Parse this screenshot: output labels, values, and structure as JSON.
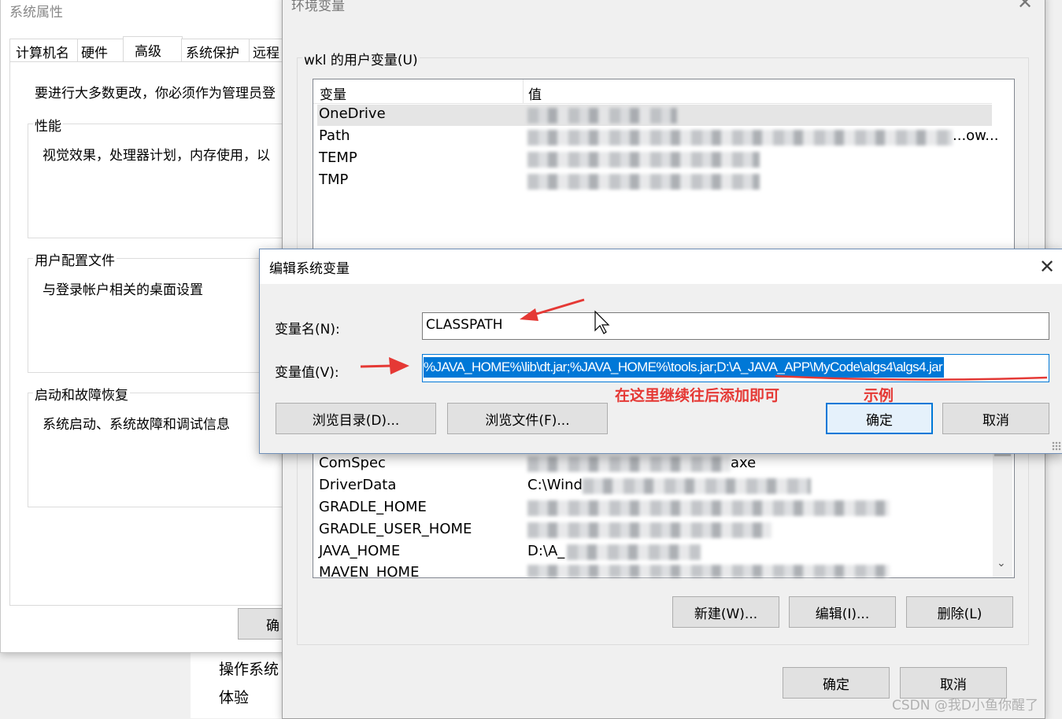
{
  "sys_props": {
    "title": "系统属性",
    "tabs": [
      "计算机名",
      "硬件",
      "高级",
      "系统保护",
      "远程"
    ],
    "admin_note": "要进行大多数更改，你必须作为管理员登",
    "perf_label": "性能",
    "perf_desc": "视觉效果，处理器计划，内存使用，以",
    "profile_label": "用户配置文件",
    "profile_desc": "与登录帐户相关的桌面设置",
    "startup_label": "启动和故障恢复",
    "startup_desc": "系统启动、系统故障和调试信息",
    "ok_partial": "确"
  },
  "background": {
    "os_text": "操作系统",
    "experience_text": "体验"
  },
  "env": {
    "title": "环境变量",
    "user_group_label": "wkl 的用户变量(U)",
    "col_var": "变量",
    "col_val": "值",
    "user_rows": [
      {
        "name": "OneDrive",
        "value": ""
      },
      {
        "name": "Path",
        "value": "...ow..."
      },
      {
        "name": "TEMP",
        "value": ""
      },
      {
        "name": "TMP",
        "value": ""
      }
    ],
    "sys_rows": [
      {
        "name": "ComSpec",
        "value": "axe"
      },
      {
        "name": "DriverData",
        "value": "C:\\Wind"
      },
      {
        "name": "GRADLE_HOME",
        "value": ""
      },
      {
        "name": "GRADLE_USER_HOME",
        "value": ""
      },
      {
        "name": "JAVA_HOME",
        "value": "D:\\A_"
      },
      {
        "name": "MAVEN_HOME",
        "value": ""
      }
    ],
    "btn_new": "新建(W)...",
    "btn_edit": "编辑(I)...",
    "btn_delete": "删除(L)",
    "btn_ok": "确定",
    "btn_cancel": "取消"
  },
  "edit": {
    "title": "编辑系统变量",
    "name_label": "变量名(N):",
    "name_value": "CLASSPATH",
    "value_label": "变量值(V):",
    "value_value": "%JAVA_HOME%\\lib\\dt.jar;%JAVA_HOME%\\tools.jar;D:\\A_JAVA_APP\\MyCode\\algs4\\algs4.jar",
    "btn_browse_dir": "浏览目录(D)...",
    "btn_browse_file": "浏览文件(F)...",
    "btn_ok": "确定",
    "btn_cancel": "取消"
  },
  "annotations": {
    "add_here": "在这里继续往后添加即可",
    "example": "示例"
  },
  "watermark": "CSDN @我D小鱼你醒了",
  "colors": {
    "selection": "#0078d7",
    "annotation_red": "#e53935",
    "focus_border": "#0078d7"
  }
}
